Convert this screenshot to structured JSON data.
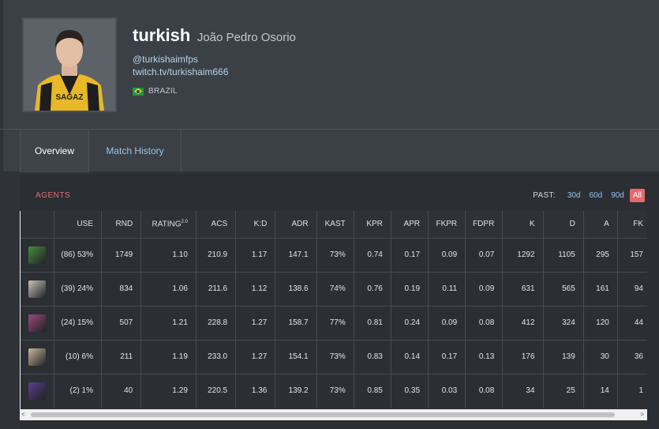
{
  "player": {
    "handle": "turkish",
    "real_name": "João Pedro Osorio",
    "twitter": "@turkishaimfps",
    "twitch": "twitch.tv/turkishaim666",
    "country": "BRAZIL",
    "jersey_text": "SAGAZ"
  },
  "tabs": [
    {
      "label": "Overview"
    },
    {
      "label": "Match History"
    }
  ],
  "agents_section": {
    "title": "AGENTS",
    "past_label": "PAST:",
    "ranges": [
      "30d",
      "60d",
      "90d",
      "All"
    ],
    "active_range": "All"
  },
  "columns": [
    "",
    "USE",
    "RND",
    "RATING",
    "ACS",
    "K:D",
    "ADR",
    "KAST",
    "KPR",
    "APR",
    "FKPR",
    "FDPR",
    "K",
    "D",
    "A",
    "FK"
  ],
  "rating_sup": "2.0",
  "rows": [
    {
      "agent_icon": "agent-1-icon",
      "color": "#4a8a3c",
      "cells": [
        "(86) 53%",
        "1749",
        "1.10",
        "210.9",
        "1.17",
        "147.1",
        "73%",
        "0.74",
        "0.17",
        "0.09",
        "0.07",
        "1292",
        "1105",
        "295",
        "157"
      ]
    },
    {
      "agent_icon": "agent-2-icon",
      "color": "#c9c4b8",
      "cells": [
        "(39) 24%",
        "834",
        "1.06",
        "211.6",
        "1.12",
        "138.6",
        "74%",
        "0.76",
        "0.19",
        "0.11",
        "0.09",
        "631",
        "565",
        "161",
        "94"
      ]
    },
    {
      "agent_icon": "agent-3-icon",
      "color": "#9b4a7a",
      "cells": [
        "(24) 15%",
        "507",
        "1.21",
        "228.8",
        "1.27",
        "158.7",
        "77%",
        "0.81",
        "0.24",
        "0.09",
        "0.08",
        "412",
        "324",
        "120",
        "44"
      ]
    },
    {
      "agent_icon": "agent-4-icon",
      "color": "#c8b59a",
      "cells": [
        "(10) 6%",
        "211",
        "1.19",
        "233.0",
        "1.27",
        "154.1",
        "73%",
        "0.83",
        "0.14",
        "0.17",
        "0.13",
        "176",
        "139",
        "30",
        "36"
      ]
    },
    {
      "agent_icon": "agent-5-icon",
      "color": "#5a3f8a",
      "cells": [
        "(2) 1%",
        "40",
        "1.29",
        "220.5",
        "1.36",
        "139.2",
        "73%",
        "0.85",
        "0.35",
        "0.03",
        "0.08",
        "34",
        "25",
        "14",
        "1"
      ]
    }
  ],
  "scrollbar": {
    "left_arrow": "<",
    "right_arrow": ">"
  }
}
